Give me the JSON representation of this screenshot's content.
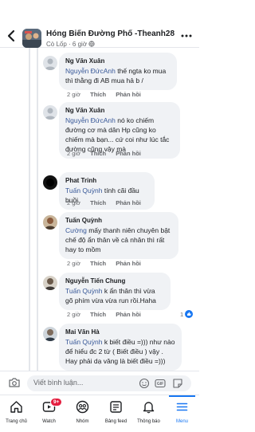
{
  "header": {
    "title": "Hóng Biến Đường Phố -Theanh28",
    "author": "Cò Lốp",
    "time": "6 giờ"
  },
  "comments": [
    {
      "author": "Ng Văn Xuân",
      "mention": "Nguyễn ĐứcAnh",
      "text": " thế ngta ko mua thì thằng đi AB mua hả b /",
      "time": "2 giờ",
      "like": "Thích",
      "reply": "Phản hồi"
    },
    {
      "author": "Ng Văn Xuân",
      "mention": "Nguyễn ĐứcAnh",
      "text": " nó ko chiếm đường cơ mà dân Hp cũng ko chiếm mà bạn... cứ coi như lúc tắc đường cũng vậy mà",
      "time": "2 giờ",
      "like": "Thích",
      "reply": "Phản hồi"
    },
    {
      "author": "Phat Trinh",
      "mention": "Tuấn Quỳnh",
      "text": " tính cãi đầu buồi",
      "time": "2 giờ",
      "like": "Thích",
      "reply": "Phản hồi"
    },
    {
      "author": "Tuấn Quỳnh",
      "mention": "Cường",
      "text": " mấy thanh niên chuyên bật chế độ ẩn thân về cả nhân thì rất hay to mồm",
      "time": "2 giờ",
      "like": "Thích",
      "reply": "Phản hồi"
    },
    {
      "author": "Nguyễn Tiến Chung",
      "mention": "Tuấn Quỳnh",
      "text": " k ẩn thân thì vừa gõ phím vừa vừa run rồi.Haha",
      "time": "2 giờ",
      "like": "Thích",
      "reply": "Phản hồi",
      "reactions": "1"
    },
    {
      "author": "Mai Văn Hà",
      "mention": "Tuấn Quỳnh",
      "text": " k biết điều =))) như nào để hiểu đc 2 từ ( Biết điều ) vậy . Hay phải dạ vâng là biết điều =)))",
      "time": "2 giờ",
      "like": "Thích",
      "reply": "Phản hồi"
    }
  ],
  "composer": {
    "placeholder": "Viết bình luận..."
  },
  "tabs": [
    {
      "label": "Trang chủ",
      "icon": "home-icon"
    },
    {
      "label": "Watch",
      "icon": "watch-icon",
      "badge": "9+"
    },
    {
      "label": "Nhóm",
      "icon": "groups-icon"
    },
    {
      "label": "Bảng feed",
      "icon": "feed-icon"
    },
    {
      "label": "Thông báo",
      "icon": "bell-icon"
    },
    {
      "label": "Menu",
      "icon": "menu-icon",
      "active": true
    }
  ],
  "colors": {
    "accent": "#1877f2",
    "mention": "#385898",
    "badge": "#e41e3f",
    "bubble": "#f0f2f5"
  }
}
